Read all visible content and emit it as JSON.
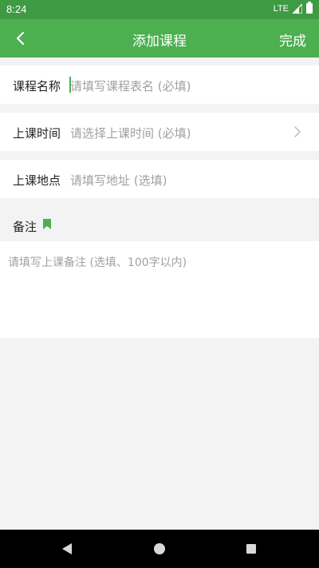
{
  "status_bar": {
    "time": "8:24",
    "network": "LTE",
    "icons": [
      "signal-icon",
      "battery-icon"
    ]
  },
  "app_bar": {
    "title": "添加课程",
    "done_label": "完成",
    "back_icon": "chevron-left-icon"
  },
  "form": {
    "course_name": {
      "label": "课程名称",
      "placeholder": "请填写课程表名 (必填)",
      "value": ""
    },
    "class_time": {
      "label": "上课时间",
      "placeholder": "请选择上课时间 (必填)",
      "icon": "chevron-right-icon"
    },
    "class_place": {
      "label": "上课地点",
      "placeholder": "请填写地址 (选填)",
      "value": ""
    },
    "note": {
      "label": "备注",
      "icon": "bookmark-icon",
      "placeholder": "请填写上课备注 (选填、100字以内)",
      "value": ""
    }
  },
  "colors": {
    "accent": "#4caf50",
    "status_bar": "#3f9a44",
    "background": "#f3f3f3",
    "placeholder": "#a0a0a0"
  },
  "nav_bar": {
    "icons": [
      "back-triangle-icon",
      "home-circle-icon",
      "recents-square-icon"
    ]
  }
}
